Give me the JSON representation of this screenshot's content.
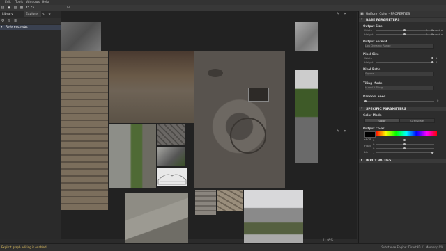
{
  "menubar": {
    "items": [
      "Edit",
      "Tools",
      "Windows",
      "Help"
    ]
  },
  "left_panel": {
    "tabs": [
      {
        "label": "Library"
      },
      {
        "label": "Explorer"
      }
    ],
    "items": [
      {
        "label": "Reference.sbs"
      }
    ]
  },
  "canvas": {
    "zoom": "11.95%",
    "description_colors": {
      "background": "#222222"
    }
  },
  "properties": {
    "title": "Uniform Color - PROPERTIES",
    "sections": {
      "base": "BASE PARAMETERS",
      "specific": "SPECIFIC PARAMETERS",
      "input_values": "INPUT VALUES"
    },
    "output_size": {
      "label": "Output Size",
      "width_label": "Width",
      "height_label": "Height",
      "width_value": "0",
      "height_value": "0",
      "width_mode": "Parent ×",
      "height_mode": "Parent ×"
    },
    "output_format": {
      "label": "Output Format",
      "value": "Low Dynamic Range"
    },
    "pixel_size": {
      "label": "Pixel Size",
      "width_label": "Width",
      "height_label": "Height",
      "width_value": "1",
      "height_value": "1"
    },
    "pixel_ratio": {
      "label": "Pixel Ratio",
      "value": "Square"
    },
    "tiling_mode": {
      "label": "Tiling Mode",
      "value": "H and V Tiling"
    },
    "random_seed": {
      "label": "Random Seed",
      "value": "0"
    },
    "color_mode": {
      "label": "Color Mode",
      "options": [
        "Color",
        "Grayscale"
      ],
      "selected": "Color"
    },
    "output_color": {
      "label": "Output Color",
      "channels": [
        "sRGB",
        "Float",
        "Lin"
      ],
      "channel_values": [
        "0",
        "0",
        "0",
        "1"
      ]
    }
  },
  "status": {
    "left": "Explicit graph editing is enabled",
    "right": "Substance Engine: Direct3D 11  Memory: 0%"
  },
  "colors": {
    "accent": "#3a4150",
    "panel": "#2d2d2d",
    "status_text": "#e0c060"
  }
}
